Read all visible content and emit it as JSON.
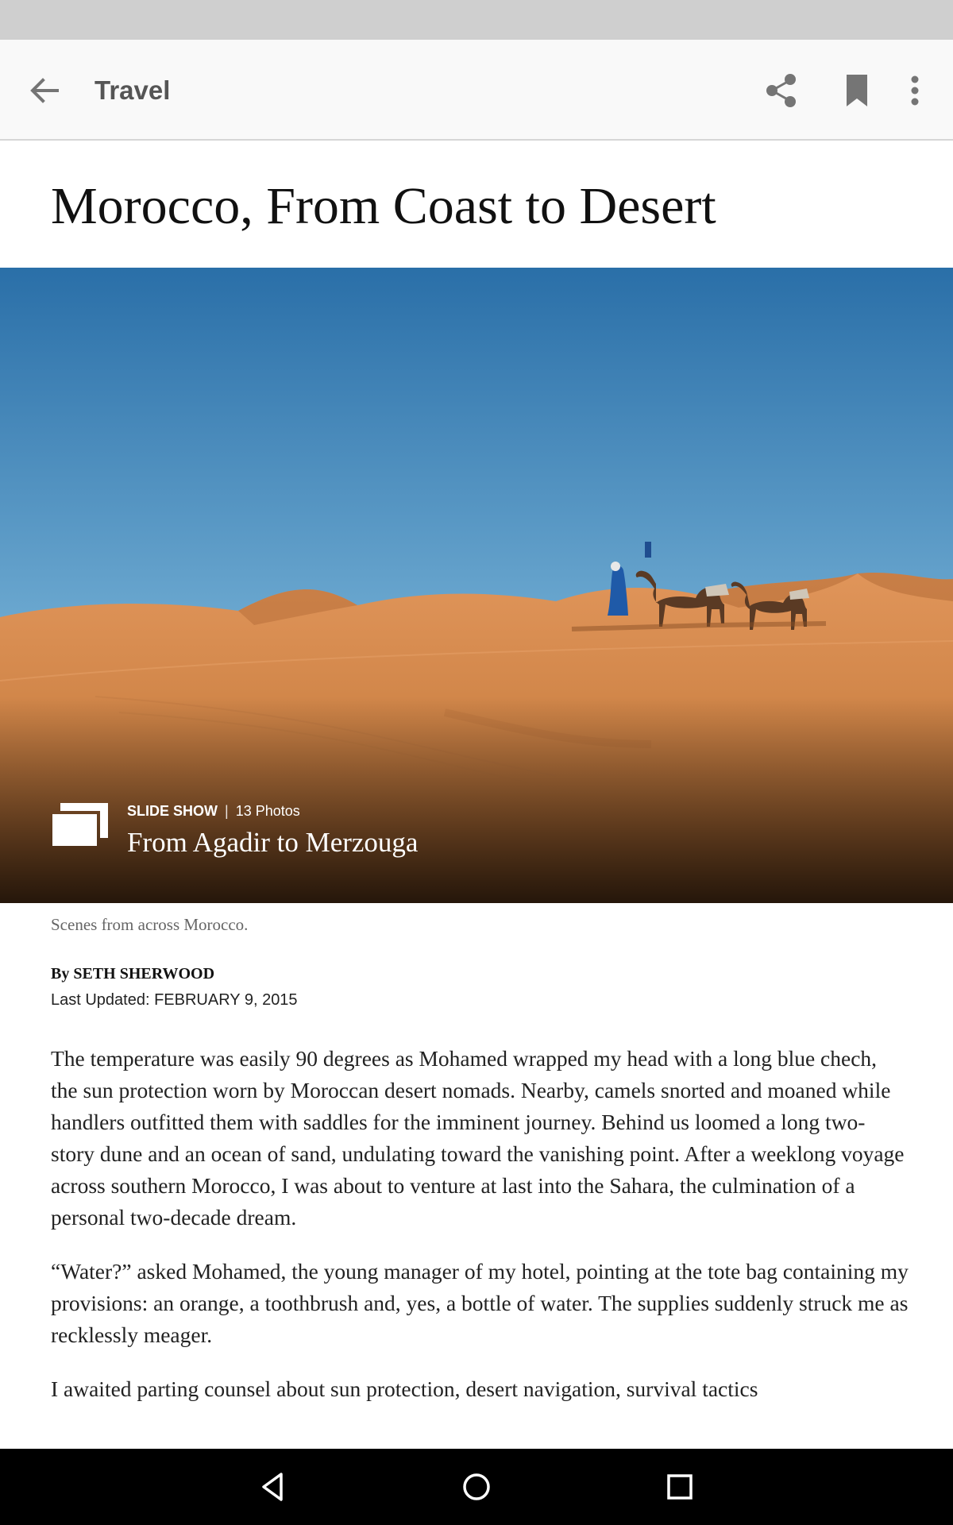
{
  "app_bar": {
    "section_title": "Travel",
    "icons": [
      "back-arrow-icon",
      "share-icon",
      "bookmark-icon",
      "more-vert-icon"
    ]
  },
  "article": {
    "headline": "Morocco, From Coast to Desert",
    "slideshow": {
      "kicker": "SLIDE SHOW",
      "separator": "|",
      "count": "13 Photos",
      "title": "From Agadir to Merzouga"
    },
    "caption": "Scenes from across Morocco.",
    "byline": "By SETH SHERWOOD",
    "last_updated": "Last Updated: FEBRUARY 9, 2015",
    "paragraphs": [
      "The temperature was easily 90 degrees as Mohamed wrapped my head with a long blue chech, the sun protection worn by Moroccan desert nomads. Nearby, camels snorted and moaned while handlers outfitted them with saddles for the imminent journey. Behind us loomed a long two-story dune and an ocean of sand, undulating toward the vanishing point. After a weeklong voyage across southern Morocco, I was about to venture at last into the Sahara, the culmination of a personal two-decade dream.",
      "“Water?” asked Mohamed, the young manager of my hotel, pointing at the tote bag containing my provisions: an orange, a toothbrush and, yes, a bottle of water. The supplies suddenly struck me as recklessly meager.",
      "I awaited parting counsel about sun protection, desert navigation, survival tactics"
    ]
  },
  "nav_bar": {
    "icons": [
      "nav-back-icon",
      "nav-home-icon",
      "nav-recents-icon"
    ]
  },
  "colors": {
    "status_bar": "#cfcfcf",
    "app_bar": "#f9f9f9",
    "sky_top": "#2d74ac",
    "sky_bottom": "#b6d6e6",
    "sand": "#d98c4b",
    "nav_bar": "#000000"
  }
}
